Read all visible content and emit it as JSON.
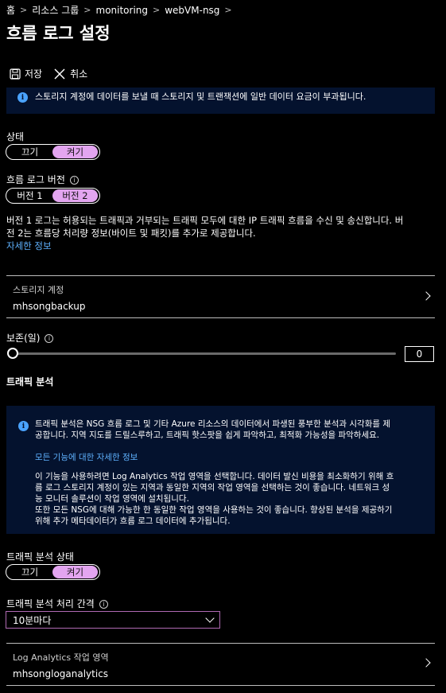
{
  "breadcrumb": {
    "items": [
      "홈",
      "리소스 그룹",
      "monitoring",
      "webVM-nsg"
    ]
  },
  "page_title": "흐름 로그 설정",
  "commands": {
    "save": "저장",
    "cancel": "취소"
  },
  "top_info": {
    "text": "스토리지 계정에 데이터를 보낼 때 스토리지 및 트랜잭션에 일반 데이터 요금이 부과됩니다."
  },
  "status": {
    "label": "상태",
    "off": "끄기",
    "on": "켜기",
    "selected": "켜기"
  },
  "version": {
    "label": "흐름 로그 버전",
    "v1": "버전 1",
    "v2": "버전 2",
    "selected": "버전 2",
    "description_line1": "버전 1 로그는 허용되는 트래픽과 거부되는 트래픽 모두에 대한 IP 트래픽 흐름을 수신 및 송신합니다. 버",
    "description_line2": "전 2는 흐름당 처리량 정보(바이트 및 패킷)를 추가로 제공합니다.",
    "learn_more": "자세한 정보"
  },
  "storage": {
    "label": "스토리지 계정",
    "value": "mhsongbackup"
  },
  "retention": {
    "label": "보존(일)",
    "value": "0"
  },
  "traffic_analytics": {
    "heading": "트래픽 분석",
    "info_line1": "트래픽 분석은 NSG 흐름 로그 및 기타 Azure 리소스의 데이터에서 파생된 풍부한 분석과 시각화를 제",
    "info_line2": "공합니다. 지역 지도를 드릴스루하고, 트래픽 핫스팟을 쉽게 파악하고, 최적화 가능성을 파악하세요.",
    "info_link": "모든 기능에 대한 자세한 정보",
    "info_p2_line1": "이 기능을 사용하려면 Log Analytics 작업 영역을 선택합니다. 데이터 발신 비용을 최소화하기 위해 흐",
    "info_p2_line2": "름 로그 스토리지 계정이 있는 지역과 동일한 지역의 작업 영역을 선택하는 것이 좋습니다. 네트워크 성",
    "info_p2_line3": "능 모니터 솔루션이 작업 영역에 설치됩니다.",
    "info_p2_line4": "또한 모든 NSG에 대해 가능한 한 동일한 작업 영역을 사용하는 것이 좋습니다. 향상된 분석을 제공하기",
    "info_p2_line5": "위해 추가 메타데이터가 흐름 로그 데이터에 추가됩니다.",
    "status_label": "트래픽 분석 상태",
    "off": "끄기",
    "on": "켜기",
    "selected": "켜기",
    "interval_label": "트래픽 분석 처리 간격",
    "interval_value": "10분마다",
    "workspace_label": "Log Analytics 작업 영역",
    "workspace_value": "mhsongloganalytics"
  },
  "colors": {
    "background": "#000000",
    "info_bg": "#04122e",
    "toggle_on": "#e3a5f0",
    "link": "#5fb2ff",
    "dropdown_border": "#b06ab3"
  }
}
